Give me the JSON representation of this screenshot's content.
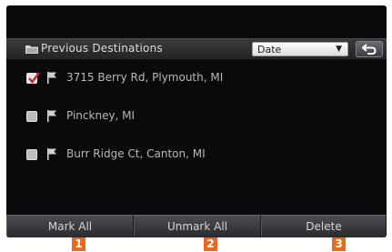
{
  "header": {
    "title": "Previous Destinations",
    "sort_value": "Date",
    "sort_arrow": "▼",
    "back_icon": "return-arrow-icon"
  },
  "destinations": [
    {
      "label": "3715 Berry Rd, Plymouth, MI",
      "checked": true
    },
    {
      "label": "Pinckney, MI",
      "checked": false
    },
    {
      "label": "Burr Ridge Ct, Canton, MI",
      "checked": false
    }
  ],
  "actions": {
    "mark_all": "Mark All",
    "unmark_all": "Unmark All",
    "delete": "Delete"
  },
  "callouts": [
    "1",
    "2",
    "3"
  ],
  "colors": {
    "screen_bg": "#0a0a0c",
    "checkmark": "#d0203a",
    "callout": "#e46b21"
  }
}
